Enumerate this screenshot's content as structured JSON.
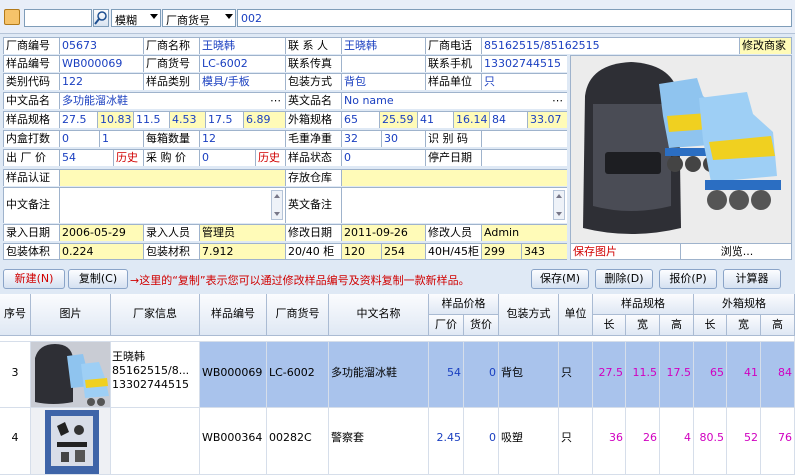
{
  "search": {
    "match_mode": "模糊",
    "field": "厂商货号",
    "value": "002"
  },
  "form": {
    "vendor_no_label": "厂商编号",
    "vendor_no": "05673",
    "vendor_name_label": "厂商名称",
    "vendor_name": "王晓韩",
    "contact_label": "联 系 人",
    "contact": "王晓韩",
    "vendor_tel_label": "厂商电话",
    "vendor_tel": "85162515/85162515",
    "edit_vendor": "修改商家",
    "sample_no_label": "样品编号",
    "sample_no": "WB000069",
    "vendor_item_label": "厂商货号",
    "vendor_item": "LC-6002",
    "fax_label": "联系传真",
    "fax": "",
    "mobile_label": "联系手机",
    "mobile": "13302744515",
    "cat_code_label": "类别代码",
    "cat_code": "122",
    "cat_label": "样品类别",
    "cat": "模具/手板",
    "pack_label": "包装方式",
    "pack": "背包",
    "unit_label": "样品单位",
    "unit": "只",
    "cn_name_label": "中文品名",
    "cn_name": "多功能溜冰鞋",
    "en_name_label": "英文品名",
    "en_name": "No name",
    "spec_label": "样品规格",
    "spec": [
      "27.5",
      "10.83",
      "11.5",
      "4.53",
      "17.5",
      "6.89"
    ],
    "ctn_label": "外箱规格",
    "ctn": [
      "65",
      "25.59",
      "41",
      "16.14",
      "84",
      "33.07"
    ],
    "inner_label": "内盒打数",
    "inner": [
      "0",
      "1"
    ],
    "perctn_label": "每箱数量",
    "perctn": "12",
    "weight_label": "毛重净重",
    "weight": [
      "32",
      "30"
    ],
    "code_label": "识 别 码",
    "code": "",
    "price_label": "出 厂 价",
    "price": "54",
    "history1": "历史",
    "buy_label": "采 购 价",
    "buy": "0",
    "history2": "历史",
    "status_label": "样品状态",
    "status": "0",
    "stop_label": "停产日期",
    "stop": "",
    "cert_label": "样品认证",
    "cert": "",
    "wh_label": "存放仓库",
    "wh": "",
    "cn_note_label": "中文备注",
    "cn_note": "",
    "en_note_label": "英文备注",
    "en_note": "",
    "in_date_label": "录入日期",
    "in_date": "2006-05-29",
    "in_user_label": "录入人员",
    "in_user": "管理员",
    "mod_date_label": "修改日期",
    "mod_date": "2011-09-26",
    "mod_user_label": "修改人员",
    "mod_user": "Admin",
    "vol_label": "包装体积",
    "vol": "0.224",
    "mat_label": "包装材积",
    "mat": "7.912",
    "c2040_label": "20/40 柜",
    "c2040": [
      "120",
      "254"
    ],
    "c40h_label": "40H/45柜",
    "c40h": [
      "299",
      "343"
    ],
    "save_pic": "保存图片",
    "browse": "浏览..."
  },
  "toolbar": {
    "new": "新建(N)",
    "copy": "复制(C)",
    "hint": "→这里的“复制”表示您可以通过修改样品编号及资料复制一款新样品。",
    "save": "保存(M)",
    "delete": "删除(D)",
    "quote": "报价(P)",
    "calc": "计算器"
  },
  "table": {
    "headers": {
      "seq": "序号",
      "pic": "图片",
      "vendor": "厂家信息",
      "sample_no": "样品编号",
      "vendor_item": "厂商货号",
      "cn_name": "中文名称",
      "price_group": "样品价格",
      "fprice": "厂价",
      "bprice": "货价",
      "pack": "包装方式",
      "unit": "单位",
      "spec_group": "样品规格",
      "ctn_group": "外箱规格",
      "l": "长",
      "w": "宽",
      "h": "高"
    },
    "rows": [
      {
        "seq": "3",
        "vendor": [
          "王晓韩",
          "85162515/8...",
          "13302744515"
        ],
        "sample_no": "WB000069",
        "vendor_item": "LC-6002",
        "cn_name": "多功能溜冰鞋",
        "fprice": "54",
        "bprice": "0",
        "pack": "背包",
        "unit": "只",
        "spec": [
          "27.5",
          "11.5",
          "17.5"
        ],
        "ctn": [
          "65",
          "41",
          "84"
        ]
      },
      {
        "seq": "4",
        "vendor": [
          "",
          "",
          ""
        ],
        "sample_no": "WB000364",
        "vendor_item": "00282C",
        "cn_name": "警察套",
        "fprice": "2.45",
        "bprice": "0",
        "pack": "吸塑",
        "unit": "只",
        "spec": [
          "36",
          "26",
          "4"
        ],
        "ctn": [
          "80.5",
          "52",
          "76"
        ]
      }
    ]
  }
}
